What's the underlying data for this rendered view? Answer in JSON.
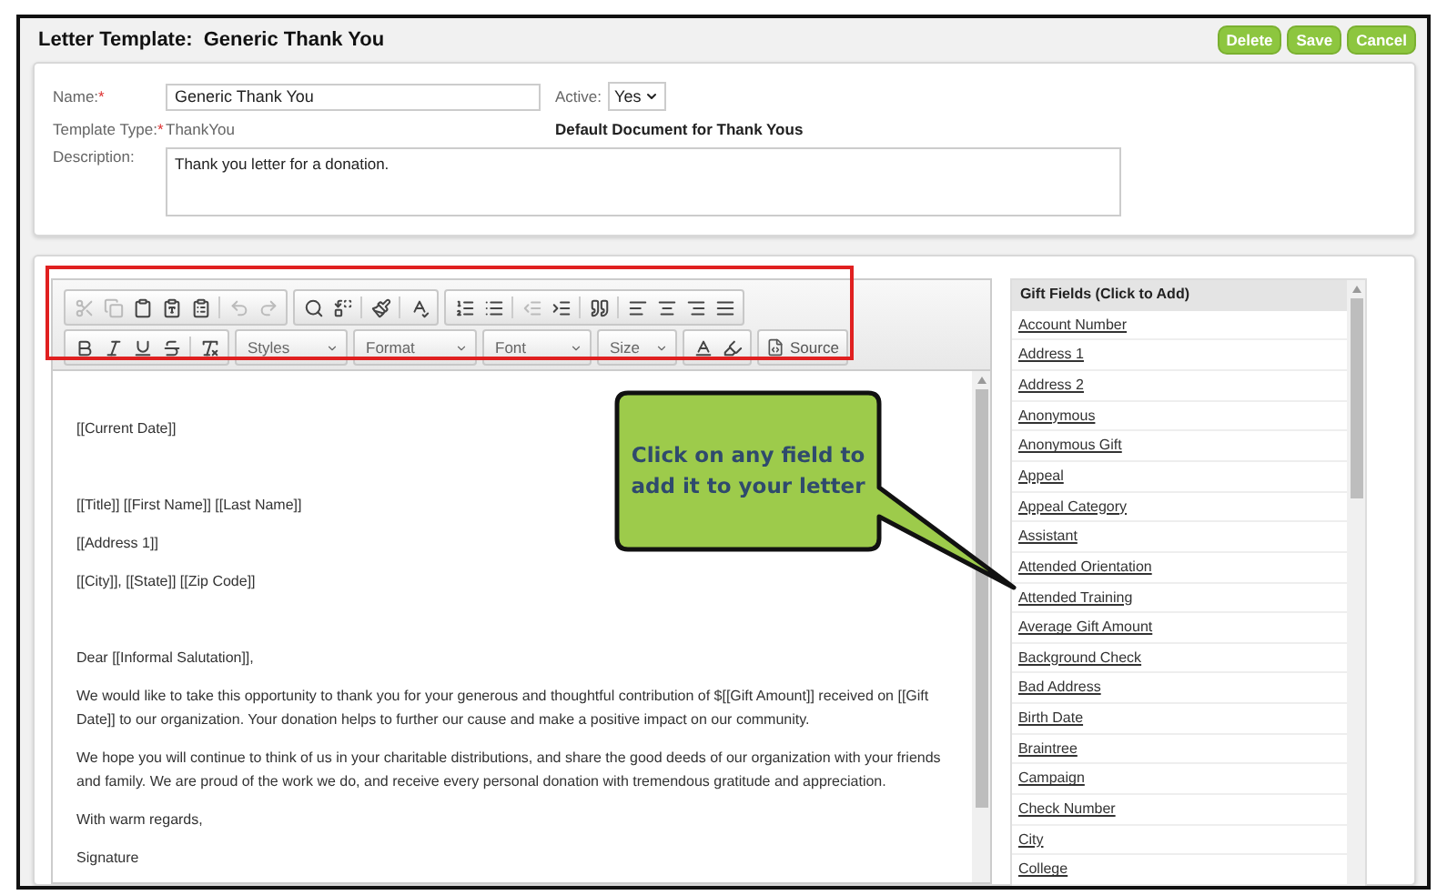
{
  "header": {
    "title": "Letter Template:  Generic Thank You",
    "buttons": [
      "Delete",
      "Save",
      "Cancel"
    ]
  },
  "form": {
    "name_label": "Name:",
    "name_mark": "*",
    "name_value": "Generic Thank You",
    "active_label": "Active:",
    "active_value": "Yes",
    "type_label": "Template Type:",
    "type_mark": "*",
    "type_value": "ThankYou",
    "default_note": "Default Document for Thank Yous",
    "description_label": "Description:",
    "description_value": "Thank you letter for a donation."
  },
  "toolbar": {
    "row_1": [
      {
        "kind": "button",
        "disabled": true
      },
      {
        "kind": "button",
        "disabled": true
      },
      {
        "kind": "button",
        "disabled": false
      },
      {
        "kind": "button",
        "disabled": false
      },
      {
        "kind": "button",
        "disabled": false
      },
      {
        "kind": "sep"
      },
      {
        "kind": "button",
        "disabled": true
      },
      {
        "kind": "button",
        "disabled": true
      },
      {
        "kind": "group"
      },
      {
        "kind": "button",
        "disabled": false
      },
      {
        "kind": "button",
        "disabled": false
      },
      {
        "kind": "sep"
      },
      {
        "kind": "button",
        "disabled": false
      },
      {
        "kind": "sep"
      },
      {
        "kind": "button",
        "disabled": false
      },
      {
        "kind": "group"
      },
      {
        "kind": "button",
        "disabled": false
      },
      {
        "kind": "button",
        "disabled": false
      },
      {
        "kind": "sep"
      },
      {
        "kind": "button",
        "disabled": true
      },
      {
        "kind": "button",
        "disabled": false
      },
      {
        "kind": "sep"
      },
      {
        "kind": "button",
        "disabled": false
      },
      {
        "kind": "sep"
      },
      {
        "kind": "button",
        "disabled": false
      },
      {
        "kind": "button",
        "disabled": false
      },
      {
        "kind": "button",
        "disabled": false
      },
      {
        "kind": "button",
        "disabled": false
      }
    ],
    "row_2": [
      {
        "kind": "button",
        "disabled": false
      },
      {
        "kind": "button",
        "disabled": false
      },
      {
        "kind": "button",
        "disabled": false
      },
      {
        "kind": "button",
        "disabled": false
      },
      {
        "kind": "sep"
      },
      {
        "kind": "button",
        "disabled": false
      },
      {
        "kind": "group"
      },
      {
        "kind": "combo",
        "label": "Styles"
      },
      {
        "kind": "group"
      },
      {
        "kind": "combo",
        "label": "Format"
      },
      {
        "kind": "group"
      },
      {
        "kind": "combo",
        "label": "Font"
      },
      {
        "kind": "group"
      },
      {
        "kind": "combo",
        "label": "Size"
      },
      {
        "kind": "group"
      },
      {
        "kind": "button",
        "disabled": false
      },
      {
        "kind": "button",
        "disabled": false
      },
      {
        "kind": "group"
      },
      {
        "kind": "source",
        "label": "Source"
      }
    ]
  },
  "letter": [
    {
      "text": "[[Current Date]]",
      "gap_after": true
    },
    {
      "text": "[[Title]] [[First Name]] [[Last Name]]",
      "gap_after": false
    },
    {
      "text": "[[Address 1]]",
      "gap_after": false
    },
    {
      "text": "[[City]], [[State]] [[Zip Code]]",
      "gap_after": true
    },
    {
      "text": "Dear [[Informal Salutation]],",
      "gap_after": false
    },
    {
      "text": "We would like to take this opportunity to thank you for your generous and thoughtful contribution of $[[Gift Amount]] received on [[Gift Date]] to our organization.  Your donation helps to further our cause and make a positive impact on our community.",
      "gap_after": false
    },
    {
      "text": "We hope you will continue to think of us in your charitable distributions, and share the good deeds of our organization with your friends and family.  We are proud of the work we do, and receive every personal donation with tremendous gratitude and appreciation.",
      "gap_after": false
    },
    {
      "text": "With warm regards,",
      "gap_after": false
    },
    {
      "text": "Signature",
      "gap_after": false
    }
  ],
  "callout": {
    "text": "Click on any field to add it to your letter"
  },
  "gift_fields": {
    "title": "Gift Fields (Click to Add)",
    "items": [
      "Account Number",
      "Address 1",
      "Address 2",
      "Anonymous",
      "Anonymous Gift",
      "Appeal",
      "Appeal Category",
      "Assistant",
      "Attended Orientation",
      "Attended Training",
      "Average Gift Amount",
      "Background Check",
      "Bad Address",
      "Birth Date",
      "Braintree",
      "Campaign",
      "Check Number",
      "City",
      "College"
    ]
  }
}
